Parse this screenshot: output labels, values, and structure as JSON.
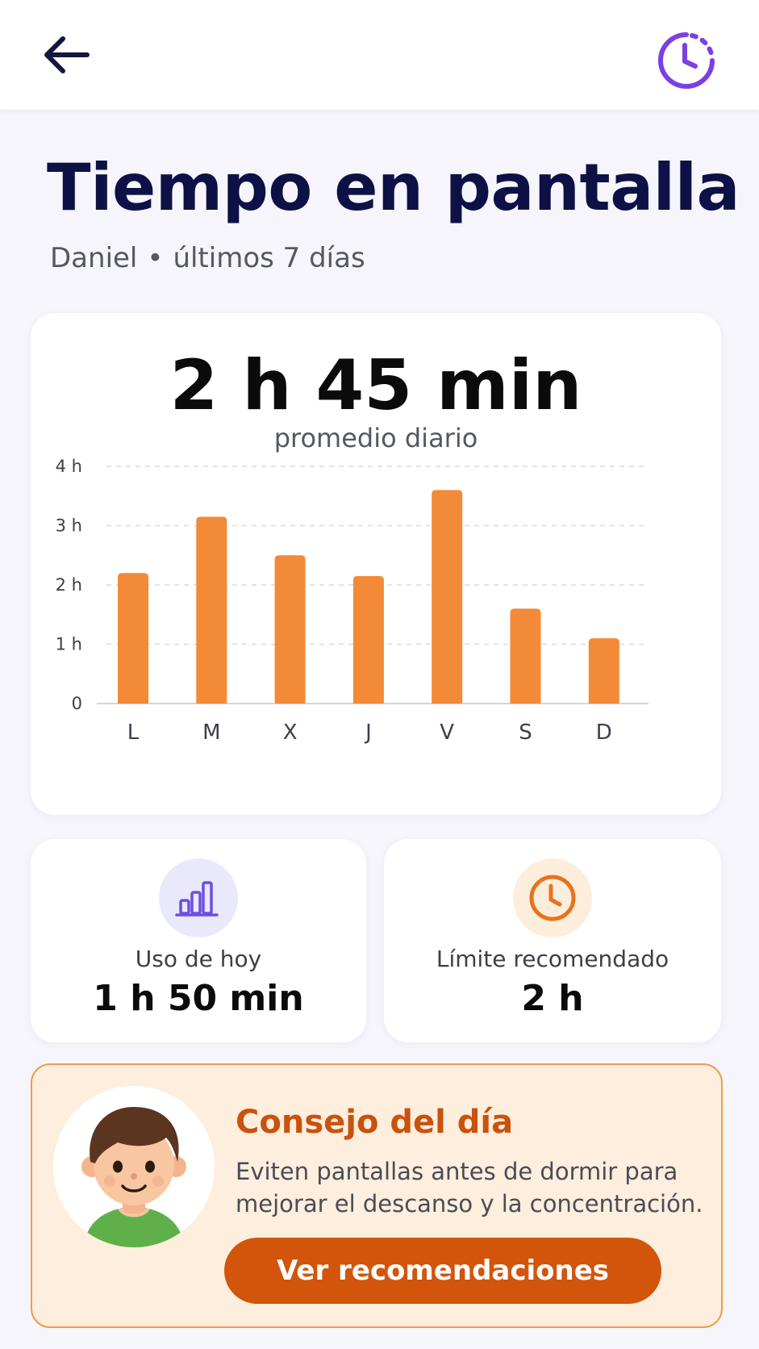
{
  "header": {
    "back_icon": "arrow-left-icon",
    "history_icon": "clock-history-icon",
    "accent_color": "#7b3fe4"
  },
  "page": {
    "title": "Tiempo en pantalla",
    "subtitle_name": "Daniel",
    "subtitle_separator": "•",
    "subtitle_period": "últimos 7 días"
  },
  "summary": {
    "average_value": "2 h 45 min",
    "average_label": "promedio diario"
  },
  "chart_data": {
    "type": "bar",
    "categories": [
      "L",
      "M",
      "X",
      "J",
      "V",
      "S",
      "D"
    ],
    "values": [
      2.2,
      3.15,
      2.5,
      2.15,
      3.6,
      1.6,
      1.1
    ],
    "ylim": [
      0,
      4
    ],
    "y_ticks": [
      0,
      1,
      2,
      3,
      4
    ],
    "y_tick_labels": [
      "0",
      "1 h",
      "2 h",
      "3 h",
      "4 h"
    ],
    "grid": true,
    "bar_color": "#f28a38"
  },
  "stats": [
    {
      "icon": "bar-chart-icon",
      "label": "Uso de hoy",
      "value": "1 h 50 min"
    },
    {
      "icon": "clock-icon",
      "label": "Límite recomendado",
      "value": "2 h"
    }
  ],
  "tip": {
    "avatar": "boy-avatar",
    "title": "Consejo del día",
    "text": "Eviten pantallas antes de dormir para mejorar el descanso y la concentración.",
    "button_label": "Ver recomendaciones"
  },
  "colors": {
    "title": "#0e1145",
    "bar": "#f28a38",
    "tip_title": "#c9520d",
    "button": "#d2550b",
    "tip_background": "#fdeedd"
  }
}
